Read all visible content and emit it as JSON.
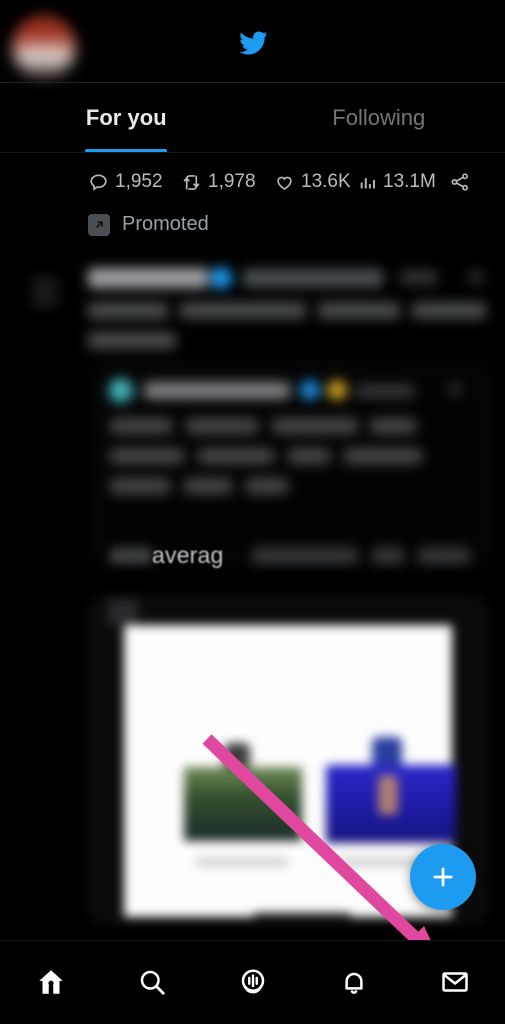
{
  "app": {
    "name": "Twitter",
    "logo_icon": "twitter-bird-icon",
    "theme": "dark",
    "accent_color": "#1D9BF0",
    "background_color": "#000000"
  },
  "header": {
    "avatar_icon": "profile-avatar",
    "logo_icon": "twitter-bird-icon"
  },
  "tabs": [
    {
      "label": "For you",
      "active": true
    },
    {
      "label": "Following",
      "active": false
    }
  ],
  "tweet": {
    "metrics": [
      {
        "name": "replies",
        "icon": "reply-icon",
        "value": "1,952"
      },
      {
        "name": "retweets",
        "icon": "retweet-icon",
        "value": "1,978"
      },
      {
        "name": "likes",
        "icon": "heart-icon",
        "value": "13.6K"
      },
      {
        "name": "views",
        "icon": "analytics-icon",
        "value": "13.1M"
      },
      {
        "name": "share",
        "icon": "share-icon",
        "value": ""
      }
    ],
    "promoted": {
      "label": "Promoted",
      "icon": "promoted-arrow-icon"
    },
    "body_partial_text": "averag",
    "content_state": "blurred"
  },
  "compose": {
    "label": "+",
    "icon": "plus-icon",
    "color": "#1D9BF0"
  },
  "annotation": {
    "type": "arrow",
    "color": "#E0479E",
    "points_to": "messages-nav-item"
  },
  "bottom_nav": [
    {
      "name": "home",
      "icon": "home-icon",
      "active": true
    },
    {
      "name": "search",
      "icon": "search-icon",
      "active": false
    },
    {
      "name": "spaces",
      "icon": "spaces-icon",
      "active": false
    },
    {
      "name": "notifications",
      "icon": "bell-icon",
      "active": false
    },
    {
      "name": "messages",
      "icon": "envelope-icon",
      "active": false
    }
  ]
}
